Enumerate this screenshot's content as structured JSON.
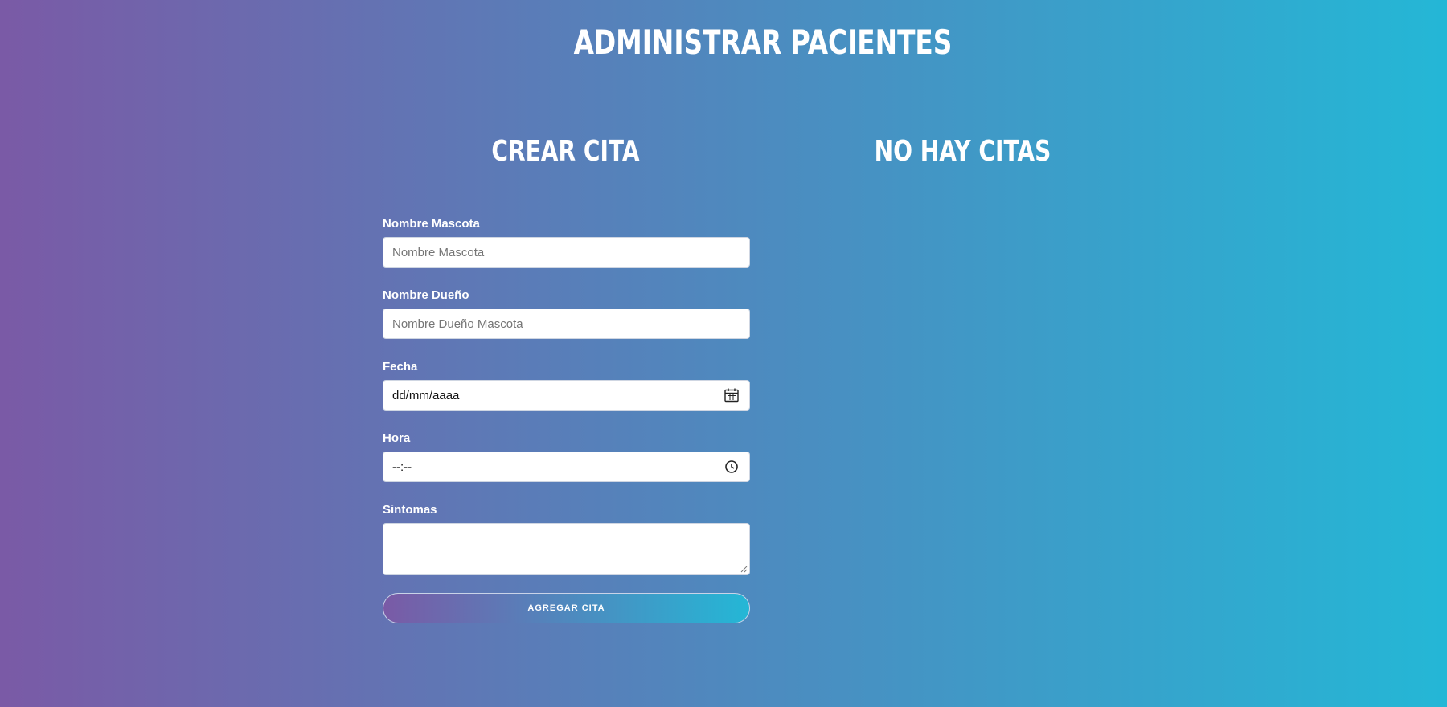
{
  "header": {
    "title": "ADMINISTRAR PACIENTES"
  },
  "form_section": {
    "title": "CREAR CITA",
    "fields": [
      {
        "label": "Nombre Mascota",
        "placeholder": "Nombre Mascota",
        "value": ""
      },
      {
        "label": "Nombre Dueño",
        "placeholder": "Nombre Dueño Mascota",
        "value": ""
      },
      {
        "label": "Fecha",
        "display": "dd/mm/aaaa",
        "icon": "calendar-icon"
      },
      {
        "label": "Hora",
        "display": "--:--",
        "icon": "clock-icon"
      },
      {
        "label": "Sintomas",
        "value": ""
      }
    ],
    "submit_label": "AGREGAR CITA"
  },
  "appointments_section": {
    "title": "NO HAY CITAS"
  },
  "colors": {
    "gradient_start": "#7a5aa6",
    "gradient_end": "#24b7d6"
  }
}
